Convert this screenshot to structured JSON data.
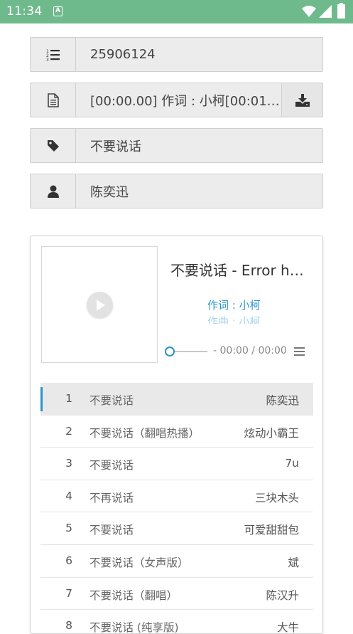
{
  "status_bar": {
    "time": "11:34",
    "app_icon": "A"
  },
  "fields": {
    "id": {
      "icon": "ordered-list-icon",
      "value": "25906124"
    },
    "lyric": {
      "icon": "file-text-icon",
      "value": "[00:00.00] 作词 : 小柯[00:01…",
      "action_icon": "download-icon"
    },
    "title": {
      "icon": "tag-icon",
      "value": "不要说话"
    },
    "artist": {
      "icon": "user-icon",
      "value": "陈奕迅"
    }
  },
  "player": {
    "title": "不要说话 - Error h…",
    "lyric_current": "作词 : 小柯",
    "lyric_next": "作曲 : 小柯",
    "time": "- 00:00 / 00:00",
    "progress": 0
  },
  "playlist": [
    {
      "num": "1",
      "name": "不要说话",
      "artist": "陈奕迅",
      "active": true
    },
    {
      "num": "2",
      "name": "不要说话（翻唱热播）",
      "artist": "炫动小霸王"
    },
    {
      "num": "3",
      "name": "不要说话",
      "artist": "7u"
    },
    {
      "num": "4",
      "name": "不再说话",
      "artist": "三块木头"
    },
    {
      "num": "5",
      "name": "不要说话",
      "artist": "可爱甜甜包"
    },
    {
      "num": "6",
      "name": "不要说话（女声版）",
      "artist": "斌"
    },
    {
      "num": "7",
      "name": "不要说话（翻唱）",
      "artist": "陈汉升"
    },
    {
      "num": "8",
      "name": "不要说话 (纯享版)",
      "artist": "大牛"
    }
  ],
  "colors": {
    "status_bar": "#6fba8c",
    "accent": "#2a93c9"
  }
}
